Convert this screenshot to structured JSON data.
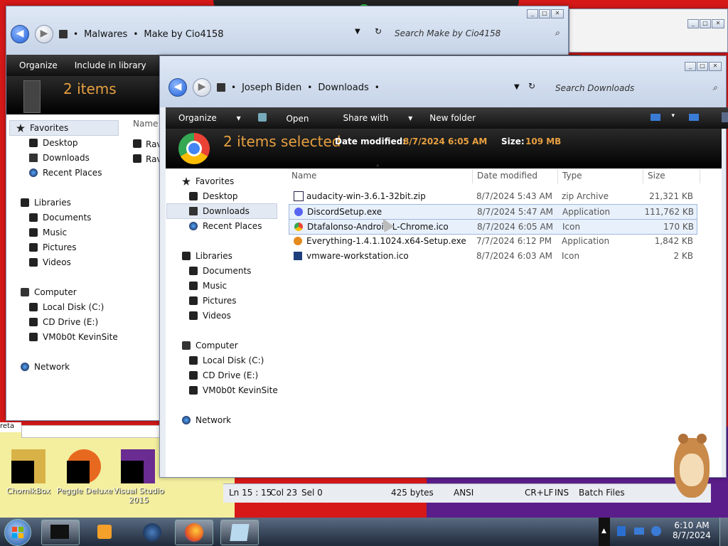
{
  "window_back": {
    "breadcrumb": [
      "Malwares",
      "Make by Cio4158"
    ],
    "search_placeholder": "Search Make by Cio4158",
    "toolbar": [
      "Organize",
      "Include in library"
    ],
    "count_text": "2 items",
    "nav": {
      "favorites": "Favorites",
      "desktop": "Desktop",
      "downloads": "Downloads",
      "recent": "Recent Places",
      "libraries": "Libraries",
      "documents": "Documents",
      "music": "Music",
      "pictures": "Pictures",
      "videos": "Videos",
      "computer": "Computer",
      "local_disk": "Local Disk (C:)",
      "cd_drive": "CD Drive (E:)",
      "vm": "VM0b0t KevinSite",
      "network": "Network"
    },
    "column_name": "Name",
    "files": [
      "Rav",
      "Rav"
    ]
  },
  "window_front": {
    "breadcrumb": [
      "Joseph Biden",
      "Downloads"
    ],
    "search_placeholder": "Search Downloads",
    "toolbar": {
      "organize": "Organize",
      "open": "Open",
      "share": "Share with",
      "new_folder": "New folder"
    },
    "details": {
      "selected_text": "2 items selected",
      "date_label": "Date modified:",
      "date_value": "8/7/2024 6:05 AM",
      "size_label": "Size:",
      "size_value": "109 MB"
    },
    "nav": {
      "favorites": "Favorites",
      "desktop": "Desktop",
      "downloads": "Downloads",
      "recent": "Recent Places",
      "libraries": "Libraries",
      "documents": "Documents",
      "music": "Music",
      "pictures": "Pictures",
      "videos": "Videos",
      "computer": "Computer",
      "local_disk": "Local Disk (C:)",
      "cd_drive": "CD Drive (E:)",
      "vm": "VM0b0t KevinSite",
      "network": "Network"
    },
    "columns": {
      "name": "Name",
      "date": "Date modified",
      "type": "Type",
      "size": "Size"
    },
    "files": [
      {
        "name": "audacity-win-3.6.1-32bit.zip",
        "date": "8/7/2024 5:43 AM",
        "type": "zip Archive",
        "size": "21,321 KB"
      },
      {
        "name": "DiscordSetup.exe",
        "date": "8/7/2024 5:47 AM",
        "type": "Application",
        "size": "111,762 KB"
      },
      {
        "name": "Dtafalonso-Android-L-Chrome.ico",
        "date": "8/7/2024 6:05 AM",
        "type": "Icon",
        "size": "170 KB"
      },
      {
        "name": "Everything-1.4.1.1024.x64-Setup.exe",
        "date": "7/7/2024 6:12 PM",
        "type": "Application",
        "size": "1,842 KB"
      },
      {
        "name": "vmware-workstation.ico",
        "date": "8/7/2024 6:03 AM",
        "type": "Icon",
        "size": "2 KB"
      }
    ]
  },
  "editor_status": {
    "position": "Ln 15 : 15",
    "col": "Col 23",
    "sel": "Sel 0",
    "bytes": "425 bytes",
    "encoding": "ANSI",
    "eol": "CR+LF",
    "mode": "INS",
    "lang": "Batch Files"
  },
  "desktop_icons": [
    "ChomikBox",
    "Peggle Deluxe",
    "Visual Studio 2015"
  ],
  "desktop_fragment": "reta",
  "clock": {
    "time": "6:10 AM",
    "date": "8/7/2024"
  },
  "colors": {
    "accent": "#1f5fd6",
    "selected_text": "#e8a040",
    "desktop": "#d61818"
  }
}
